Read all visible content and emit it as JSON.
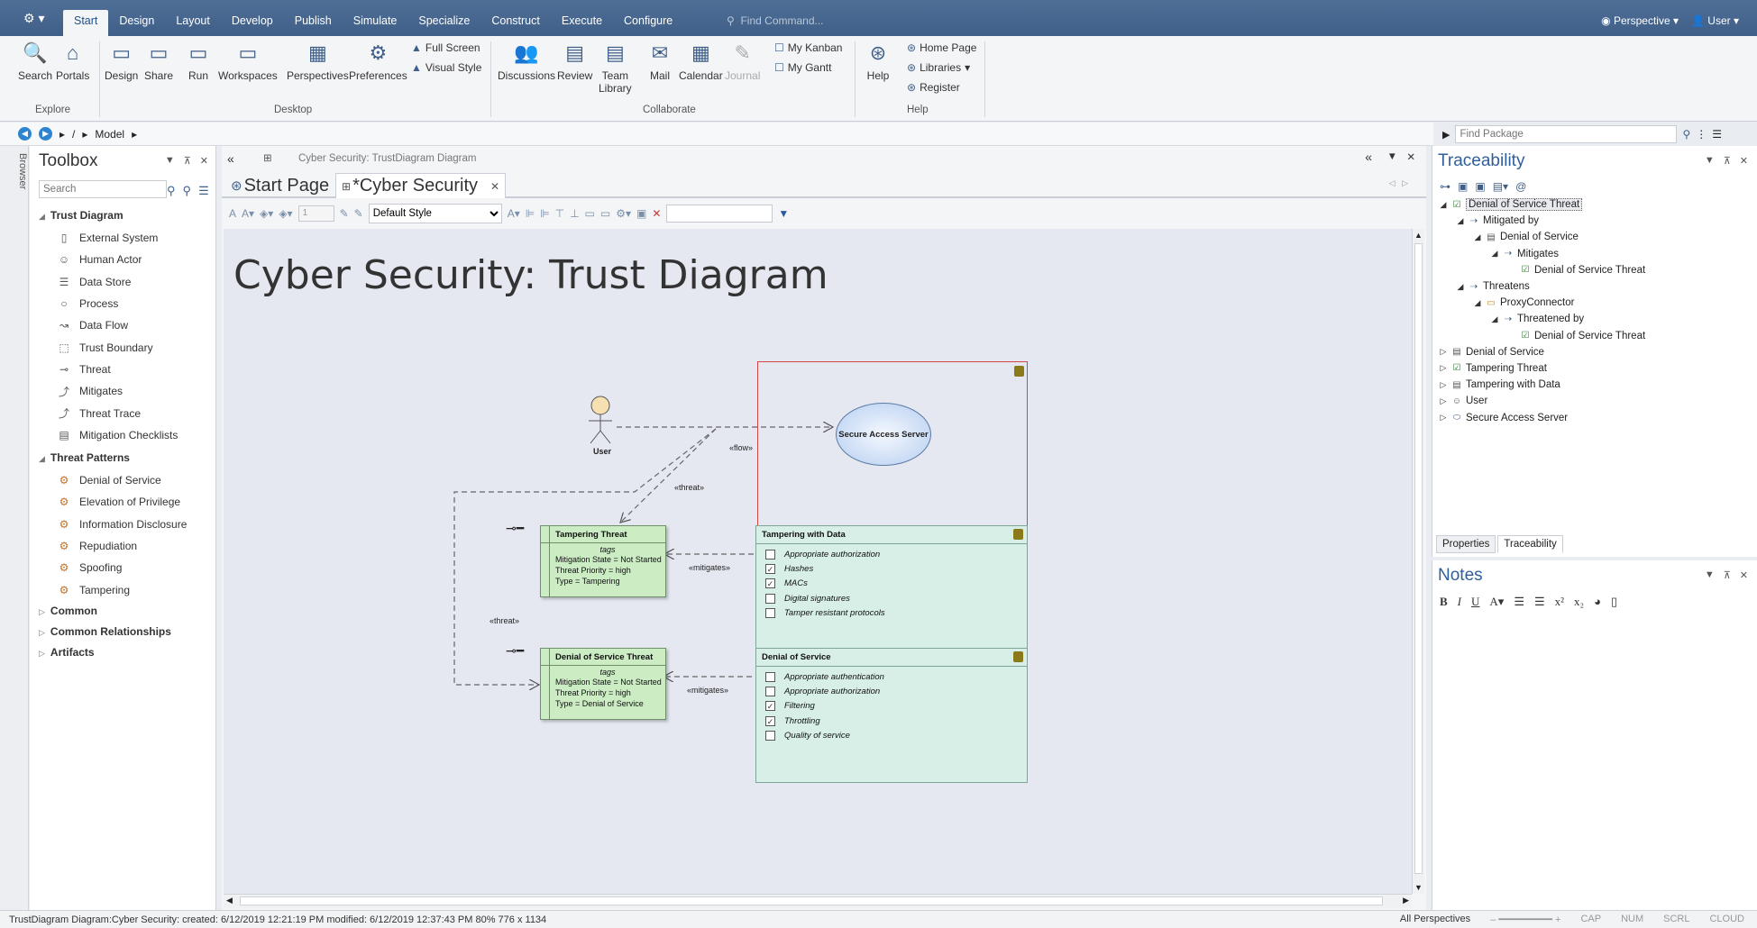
{
  "menubar": {
    "logo_icon": "ea-logo-icon",
    "tabs": [
      "Start",
      "Design",
      "Layout",
      "Develop",
      "Publish",
      "Simulate",
      "Specialize",
      "Construct",
      "Execute",
      "Configure"
    ],
    "active_tab": "Start",
    "find_command_placeholder": "Find Command...",
    "perspective_label": "Perspective",
    "user_label": "User"
  },
  "ribbon": {
    "explore": {
      "group": "Explore",
      "search": "Search",
      "portals": "Portals"
    },
    "desktop": {
      "group": "Desktop",
      "design": "Design",
      "share": "Share",
      "run": "Run",
      "workspaces": "Workspaces",
      "perspectives": "Perspectives",
      "preferences": "Preferences",
      "full_screen": "Full Screen",
      "visual_style": "Visual Style"
    },
    "collaborate": {
      "group": "Collaborate",
      "discussions": "Discussions",
      "review": "Review",
      "team": "Team",
      "library": "Library",
      "mail": "Mail",
      "calendar": "Calendar",
      "journal": "Journal",
      "my_kanban": "My Kanban",
      "my_gantt": "My Gantt"
    },
    "help": {
      "group": "Help",
      "help": "Help",
      "home_page": "Home Page",
      "libraries": "Libraries",
      "register": "Register"
    }
  },
  "address": {
    "sep": "/",
    "crumb": "Model",
    "find_package_placeholder": "Find Package"
  },
  "rail": {
    "label": "Browser"
  },
  "toolbox": {
    "title": "Toolbox",
    "search_placeholder": "Search",
    "trust_section": "Trust Diagram",
    "trust_items": [
      "External System",
      "Human Actor",
      "Data Store",
      "Process",
      "Data Flow",
      "Trust Boundary",
      "Threat",
      "Mitigates",
      "Threat Trace",
      "Mitigation Checklists"
    ],
    "patterns_section": "Threat Patterns",
    "pattern_items": [
      "Denial of Service",
      "Elevation of Privilege",
      "Information Disclosure",
      "Repudiation",
      "Spoofing",
      "Tampering"
    ],
    "collapsed_sections": [
      "Common",
      "Common Relationships",
      "Artifacts"
    ]
  },
  "document": {
    "breadcrumb": "Cyber Security:  TrustDiagram Diagram",
    "tabs": [
      "Start Page",
      "*Cyber Security"
    ],
    "style_select": "Default Style",
    "zoom_field": "1"
  },
  "diagram": {
    "title": "Cyber Security: Trust Diagram",
    "actor": "User",
    "server": "Secure Access Server",
    "labels": {
      "flow": "«flow»",
      "threat1": "«threat»",
      "threat2": "«threat»",
      "mitigates1": "«mitigates»",
      "mitigates2": "«mitigates»"
    },
    "threats": [
      {
        "name": "Tampering Threat",
        "tags": "tags",
        "rows": [
          "Mitigation State = Not Started",
          "Threat Priority = high",
          "Type = Tampering"
        ]
      },
      {
        "name": "Denial of Service Threat",
        "tags": "tags",
        "rows": [
          "Mitigation State = Not Started",
          "Threat Priority = high",
          "Type = Denial of Service"
        ]
      }
    ],
    "mitigations": [
      {
        "name": "Tampering with Data",
        "items": [
          {
            "text": "Appropriate authorization",
            "checked": false
          },
          {
            "text": "Hashes",
            "checked": true
          },
          {
            "text": "MACs",
            "checked": true
          },
          {
            "text": "Digital signatures",
            "checked": false
          },
          {
            "text": "Tamper resistant protocols",
            "checked": false
          }
        ]
      },
      {
        "name": "Denial of Service",
        "items": [
          {
            "text": "Appropriate authentication",
            "checked": false
          },
          {
            "text": "Appropriate authorization",
            "checked": false
          },
          {
            "text": "Filtering",
            "checked": true
          },
          {
            "text": "Throttling",
            "checked": true
          },
          {
            "text": "Quality of service",
            "checked": false
          }
        ]
      }
    ]
  },
  "traceability": {
    "title": "Traceability",
    "tree": [
      {
        "depth": 0,
        "expander": "◢",
        "icon": "checklist-icon",
        "text": "Denial of Service Threat",
        "selected": true
      },
      {
        "depth": 1,
        "expander": "◢",
        "icon": "link-icon",
        "text": "Mitigated by"
      },
      {
        "depth": 2,
        "expander": "◢",
        "icon": "document-icon",
        "text": "Denial of Service"
      },
      {
        "depth": 3,
        "expander": "◢",
        "icon": "link-icon",
        "text": "Mitigates"
      },
      {
        "depth": 4,
        "expander": "",
        "icon": "checklist-icon",
        "text": "Denial of Service Threat"
      },
      {
        "depth": 1,
        "expander": "◢",
        "icon": "link-icon",
        "text": "Threatens"
      },
      {
        "depth": 2,
        "expander": "◢",
        "icon": "folder-icon",
        "text": "ProxyConnector"
      },
      {
        "depth": 3,
        "expander": "◢",
        "icon": "link-icon",
        "text": "Threatened by"
      },
      {
        "depth": 4,
        "expander": "",
        "icon": "checklist-icon",
        "text": "Denial of Service Threat"
      },
      {
        "depth": 0,
        "expander": "▷",
        "icon": "document-icon",
        "text": "Denial of Service"
      },
      {
        "depth": 0,
        "expander": "▷",
        "icon": "checklist-icon",
        "text": "Tampering Threat"
      },
      {
        "depth": 0,
        "expander": "▷",
        "icon": "document-icon",
        "text": "Tampering with Data"
      },
      {
        "depth": 0,
        "expander": "▷",
        "icon": "actor-icon",
        "text": "User"
      },
      {
        "depth": 0,
        "expander": "▷",
        "icon": "process-icon",
        "text": "Secure Access Server"
      }
    ],
    "subtabs": [
      "Properties",
      "Traceability"
    ]
  },
  "notes": {
    "title": "Notes"
  },
  "status": {
    "text": "TrustDiagram Diagram:Cyber Security:   created: 6/12/2019 12:21:19 PM  modified: 6/12/2019 12:37:43 PM   80%   776 x 1134",
    "perspectives": "All Perspectives",
    "caps": "CAP",
    "num": "NUM",
    "scrl": "SCRL",
    "cloud": "CLOUD"
  },
  "colors": {
    "menubar": "#4f6f97",
    "boundary": "#d64545",
    "threat_fill": "#ccecc4",
    "mitigation_fill": "#d7efe7",
    "server_fill": "#b6cef0"
  }
}
